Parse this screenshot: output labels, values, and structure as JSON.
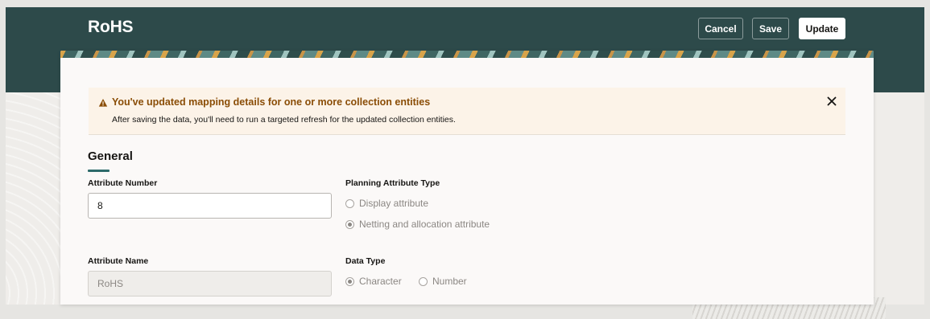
{
  "header": {
    "title": "RoHS",
    "cancel_label": "Cancel",
    "save_label": "Save",
    "update_label": "Update"
  },
  "banner": {
    "title": "You've updated mapping details for one or more collection entities",
    "message": "After saving the data, you'll need to run a targeted refresh for the updated collection entities."
  },
  "section": {
    "title": "General"
  },
  "fields": {
    "attribute_number": {
      "label": "Attribute Number",
      "value": "8"
    },
    "attribute_name": {
      "label": "Attribute Name",
      "value": "RoHS"
    },
    "planning_attribute_type": {
      "label": "Planning Attribute Type",
      "options": [
        "Display attribute",
        "Netting and allocation attribute"
      ],
      "selected": "Netting and allocation attribute"
    },
    "data_type": {
      "label": "Data Type",
      "options": [
        "Character",
        "Number"
      ],
      "selected": "Character"
    }
  },
  "colors": {
    "header_band": "#2d4a4a",
    "warning_text": "#8a4d06",
    "banner_bg": "#fcf3e8",
    "accent_underline": "#2d6a6a"
  }
}
